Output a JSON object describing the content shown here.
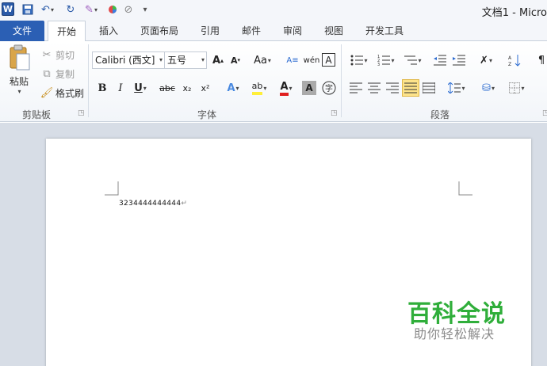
{
  "app": {
    "logo": "W",
    "title": "文档1 - Micro"
  },
  "tabs": [
    "文件",
    "开始",
    "插入",
    "页面布局",
    "引用",
    "邮件",
    "审阅",
    "视图",
    "开发工具"
  ],
  "clipboard": {
    "paste": "粘贴",
    "cut": "剪切",
    "copy": "复制",
    "format_painter": "格式刷",
    "group_label": "剪贴板"
  },
  "font": {
    "name": "Calibri (西文]",
    "size": "五号",
    "group_label": "字体",
    "case_label": "Aa",
    "bold": "B",
    "italic": "I",
    "underline": "U",
    "strike": "abc",
    "subscript": "x₂",
    "superscript": "x²"
  },
  "paragraph": {
    "group_label": "段落"
  },
  "document": {
    "text": "3234444444444",
    "mark": "↵"
  },
  "watermark": {
    "main": "百科全说",
    "sub": "助你轻松解决"
  },
  "colors": {
    "file_tab": "#2b5fb4",
    "watermark_green": "#2fae3a",
    "highlight": "#ffef3a",
    "font_red": "#e02020"
  }
}
